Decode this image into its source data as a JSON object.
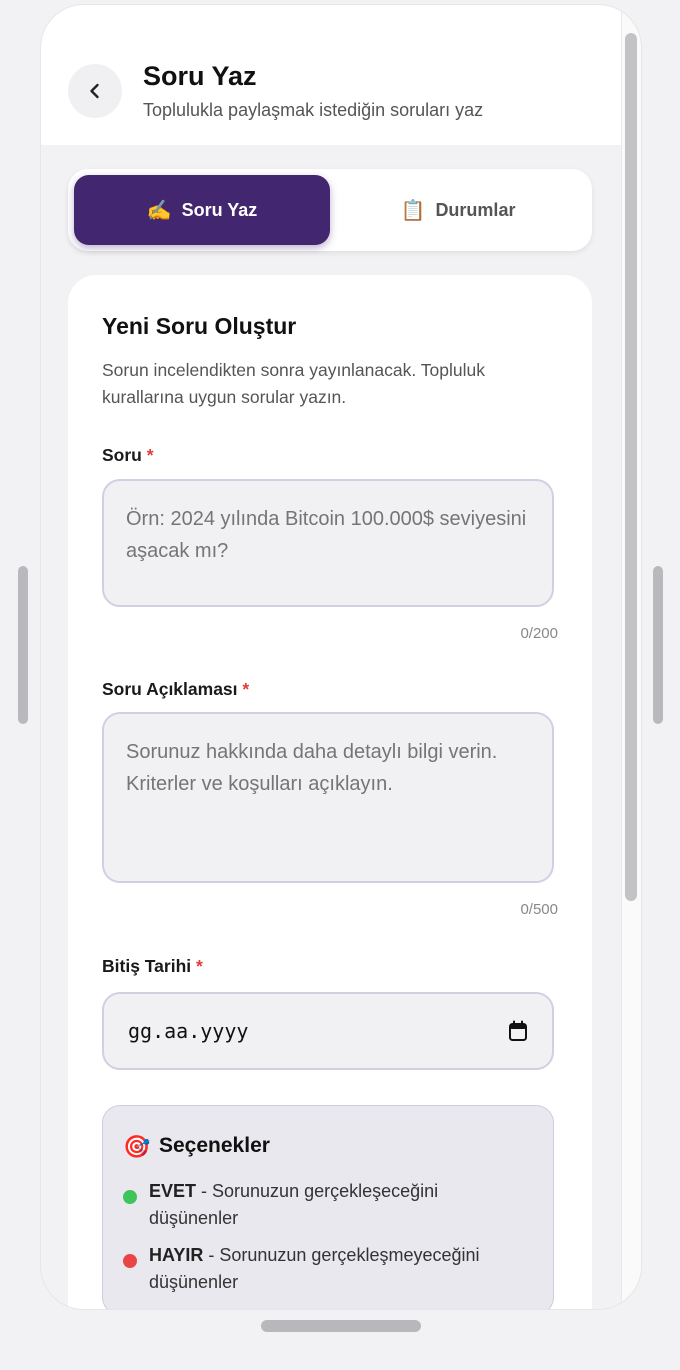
{
  "header": {
    "title": "Soru Yaz",
    "subtitle": "Toplulukla paylaşmak istediğin soruları yaz"
  },
  "tabs": [
    {
      "label": "Soru Yaz",
      "emoji": "✍️",
      "active": true
    },
    {
      "label": "Durumlar",
      "emoji": "📋",
      "active": false
    }
  ],
  "card": {
    "title": "Yeni Soru Oluştur",
    "description": "Sorun incelendikten sonra yayınlanacak. Topluluk kurallarına uygun sorular yazın."
  },
  "fields": {
    "question": {
      "label": "Soru",
      "required_mark": "*",
      "placeholder": "Örn: 2024 yılında Bitcoin 100.000$ seviyesini aşacak mı?",
      "value": "",
      "counter": "0/200"
    },
    "description": {
      "label": "Soru Açıklaması",
      "required_mark": "*",
      "placeholder": "Sorunuz hakkında daha detaylı bilgi verin. Kriterler ve koşulları açıklayın.",
      "value": "",
      "counter": "0/500"
    },
    "end_date": {
      "label": "Bitiş Tarihi",
      "required_mark": "*",
      "value": "gg.aa.yyyy",
      "icon": "calendar-icon"
    }
  },
  "options": {
    "icon": "🎯",
    "title": "Seçenekler",
    "items": [
      {
        "key": "EVET",
        "text": " - Sorunuzun gerçekleşeceğini düşünenler",
        "color": "#3fc45a"
      },
      {
        "key": "HAYIR",
        "text": " - Sorunuzun gerçekleşmeyeceğini düşünenler",
        "color": "#ea4545"
      }
    ]
  },
  "colors": {
    "accent": "#432670",
    "required": "#e23b3b"
  }
}
